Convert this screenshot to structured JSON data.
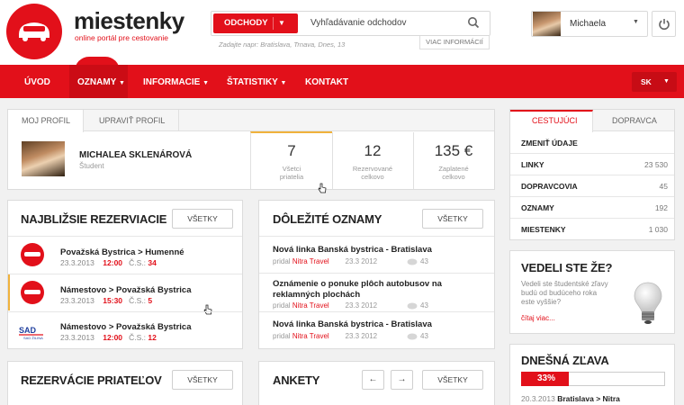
{
  "header": {
    "brand": "miestenky",
    "brand_sub": "online portál pre cestovanie",
    "search": {
      "select_label": "ODCHODY",
      "placeholder": "Vyhľadávanie odchodov",
      "hint": "Zadajte napr: Bratislava, Trnava, Dnes, 13",
      "more_info": "VIAC INFORMÁCIÍ"
    },
    "user_name": "Michaela"
  },
  "nav": {
    "items": [
      "ÚVOD",
      "OZNAMY",
      "INFORMACIE",
      "ŠTATISTIKY",
      "KONTAKT"
    ],
    "active": "OZNAMY",
    "language": "SK"
  },
  "profile": {
    "tabs": [
      "MOJ PROFIL",
      "UPRAVIŤ PROFIL"
    ],
    "name": "MICHALEA SKLENÁROVÁ",
    "role": "Študent",
    "stats": [
      {
        "value": "7",
        "label1": "Všetci",
        "label2": "priatelia"
      },
      {
        "value": "12",
        "label1": "Rezervované",
        "label2": "celkovo"
      },
      {
        "value": "135 €",
        "label1": "Zaplatené",
        "label2": "celkovo"
      }
    ]
  },
  "reservations": {
    "title": "NAJBLIŽSIE REZERVIACIE",
    "button": "VŠETKY",
    "items": [
      {
        "route": "Považská Bystrica > Humenné",
        "date": "23.3.2013",
        "time": "12:00",
        "cs_label": "Č.S.:",
        "seat": "34"
      },
      {
        "route": "Námestovo > Považská Bystrica",
        "date": "23.3.2013",
        "time": "15:30",
        "cs_label": "Č.S.:",
        "seat": "5"
      },
      {
        "route": "Námestovo > Považská Bystrica",
        "date": "23.3.2013",
        "time": "12:00",
        "cs_label": "Č.S.:",
        "seat": "12"
      }
    ],
    "logo_text": "SAD ŽILINA"
  },
  "announcements": {
    "title": "DÔLEŽITÉ OZNAMY",
    "button": "VŠETKY",
    "items": [
      {
        "title": "Nová linka Banská bystrica - Bratislava",
        "added": "pridal",
        "author": "Nitra Travel",
        "date": "23.3 2012",
        "comments": "43"
      },
      {
        "title_line1": "Oznámenie o ponuke plôch autobusov na",
        "title_line2": "reklamných plochách",
        "added": "pridal",
        "author": "Nitra Travel",
        "date": "23.3 2012",
        "comments": "43"
      },
      {
        "title": "Nová linka Banská bystrica - Bratislava",
        "added": "pridal",
        "author": "Nitra Travel",
        "date": "23.3 2012",
        "comments": "43"
      }
    ]
  },
  "friends_reservations": {
    "title": "REZERVÁCIE PRIATEĽOV",
    "button": "VŠETKY"
  },
  "polls": {
    "title": "ANKETY",
    "button": "VŠETKY"
  },
  "sidebar": {
    "tabs": [
      "CESTUJÚCI",
      "DOPRAVCA"
    ],
    "change_data": "ZMENIŤ ÚDAJE",
    "rows": [
      {
        "label": "LINKY",
        "value": "23 530"
      },
      {
        "label": "DOPRAVCOVIA",
        "value": "45"
      },
      {
        "label": "OZNAMY",
        "value": "192"
      },
      {
        "label": "MIESTENKY",
        "value": "1 030"
      }
    ]
  },
  "did_you_know": {
    "title": "VEDELI STE ŽE?",
    "text_lines": [
      "Vedeli ste študentské zľavy",
      "budú od budúceho roka",
      "este vyššie?"
    ],
    "link": "čítaj viac..."
  },
  "discount": {
    "title": "DNEŠNÁ ZĽAVA",
    "percent_label": "33%",
    "percent": 33,
    "date": "20.3.2013",
    "route": "Bratislava > Nitra"
  },
  "colors": {
    "accent": "#e2101a",
    "accent_dark": "#cb0c15",
    "background": "#f1f1f1"
  }
}
